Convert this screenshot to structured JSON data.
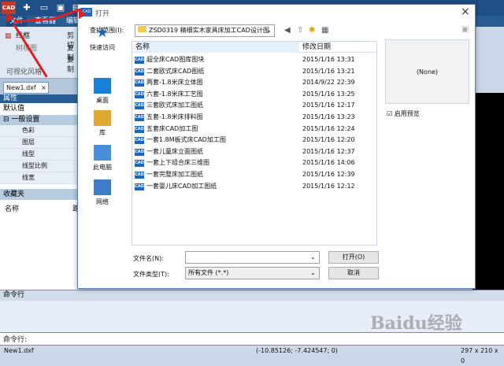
{
  "app": {
    "logo_text": "CAD",
    "menus": [
      "文件",
      "查看器",
      "编辑"
    ]
  },
  "ribbon": {
    "wire_btn": "线框",
    "group_label": "可视化风格",
    "labels": [
      "剪切",
      "复制",
      "复制"
    ],
    "tree_view": "树视图"
  },
  "doc_tab": {
    "label": "New1.dxf"
  },
  "properties": {
    "header": "属性",
    "subheader": "默认值",
    "group": "一般设置",
    "rows": [
      "色彩",
      "图层",
      "线型",
      "线型比例",
      "线宽"
    ]
  },
  "favorites": {
    "header": "收藏夹",
    "col_name": "名称",
    "col2": "路"
  },
  "command": {
    "panel_header": "命令行",
    "prompt": "命令行:"
  },
  "status": {
    "file": "New1.dxf",
    "coords": "(-10.85126; -7.424547; 0)",
    "size": "297 x 210 x 0"
  },
  "dialog": {
    "title": "打开",
    "lookin_label": "查找范围(I):",
    "lookin_value": "ZSD0319  精细实木家具床加工CAD设计图",
    "places": [
      "快速访问",
      "桌面",
      "库",
      "此电脑",
      "网络"
    ],
    "col_name": "名称",
    "col_date": "修改日期",
    "files": [
      {
        "name": "超全床CAD图库图块",
        "date": "2015/1/16 13:31"
      },
      {
        "name": "二套欧式床CAD图纸",
        "date": "2015/1/16 13:21"
      },
      {
        "name": "两套-1.8米床立体图",
        "date": "2014/9/22 22:39"
      },
      {
        "name": "六套-1.8米床工艺图",
        "date": "2015/1/16 13:25"
      },
      {
        "name": "三套欧式床加工图纸",
        "date": "2015/1/16 12:17"
      },
      {
        "name": "五套-1.8米床排料图",
        "date": "2015/1/16 13:23"
      },
      {
        "name": "五套床CAD加工图",
        "date": "2015/1/16 12:24"
      },
      {
        "name": "一套1.8M板式床CAD加工图",
        "date": "2015/1/16 12:20"
      },
      {
        "name": "一套儿童床立面图纸",
        "date": "2015/1/16 12:37"
      },
      {
        "name": "一套上下组合床三维图",
        "date": "2015/1/16 14:06"
      },
      {
        "name": "一套完整床加工图纸",
        "date": "2015/1/16 12:39"
      },
      {
        "name": "一套婴儿床CAD加工图纸",
        "date": "2015/1/16 12:12"
      }
    ],
    "preview_text": "(None)",
    "enable_preview": "启用预览",
    "filename_label": "文件名(N):",
    "filename_value": "",
    "filetype_label": "文件类型(T):",
    "filetype_value": "所有文件 (*.*)",
    "open_btn": "打开(O)",
    "cancel_btn": "取消"
  },
  "watermark": "Baidu经验",
  "colors": {
    "accent": "#1e4f86",
    "highlight": "#e02020"
  }
}
